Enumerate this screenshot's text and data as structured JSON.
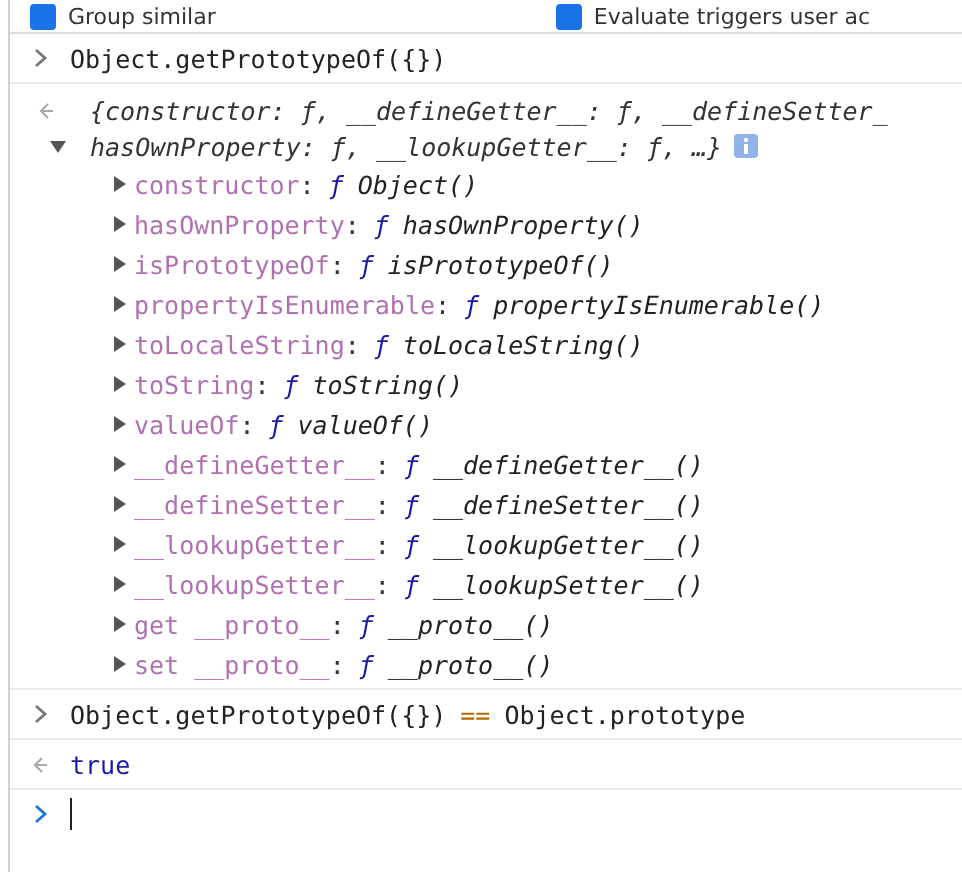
{
  "settings": [
    {
      "label": "Group similar",
      "checked": true
    },
    {
      "label": "Evaluate triggers user ac",
      "checked": true
    }
  ],
  "console": [
    {
      "kind": "input",
      "tokens": [
        {
          "text": "Object.getPrototypeOf({})",
          "kind": "plain"
        }
      ]
    },
    {
      "kind": "object",
      "expanded": true,
      "preview_lines": [
        "{constructor: ƒ, __defineGetter__: ƒ, __defineSetter_",
        "hasOwnProperty: ƒ, __lookupGetter__: ƒ, …}"
      ],
      "properties": [
        {
          "name": "constructor",
          "separator": ":",
          "marker": "ƒ",
          "signature": "Object()"
        },
        {
          "name": "hasOwnProperty",
          "separator": ":",
          "marker": "ƒ",
          "signature": "hasOwnProperty()"
        },
        {
          "name": "isPrototypeOf",
          "separator": ":",
          "marker": "ƒ",
          "signature": "isPrototypeOf()"
        },
        {
          "name": "propertyIsEnumerable",
          "separator": ":",
          "marker": "ƒ",
          "signature": "propertyIsEnumerable()"
        },
        {
          "name": "toLocaleString",
          "separator": ":",
          "marker": "ƒ",
          "signature": "toLocaleString()"
        },
        {
          "name": "toString",
          "separator": ":",
          "marker": "ƒ",
          "signature": "toString()"
        },
        {
          "name": "valueOf",
          "separator": ":",
          "marker": "ƒ",
          "signature": "valueOf()"
        },
        {
          "name": "__defineGetter__",
          "separator": ":",
          "marker": "ƒ",
          "signature": "__defineGetter__()"
        },
        {
          "name": "__defineSetter__",
          "separator": ":",
          "marker": "ƒ",
          "signature": "__defineSetter__()"
        },
        {
          "name": "__lookupGetter__",
          "separator": ":",
          "marker": "ƒ",
          "signature": "__lookupGetter__()"
        },
        {
          "name": "__lookupSetter__",
          "separator": ":",
          "marker": "ƒ",
          "signature": "__lookupSetter__()"
        },
        {
          "name": "get __proto__",
          "separator": ":",
          "marker": "ƒ",
          "signature": "__proto__()"
        },
        {
          "name": "set __proto__",
          "separator": ":",
          "marker": "ƒ",
          "signature": "__proto__()"
        }
      ]
    },
    {
      "kind": "input",
      "tokens": [
        {
          "text": "Object.getPrototypeOf({})",
          "kind": "plain"
        },
        {
          "text": "==",
          "kind": "operator"
        },
        {
          "text": "Object.prototype",
          "kind": "plain"
        }
      ]
    },
    {
      "kind": "result",
      "value": "true"
    },
    {
      "kind": "prompt"
    }
  ]
}
